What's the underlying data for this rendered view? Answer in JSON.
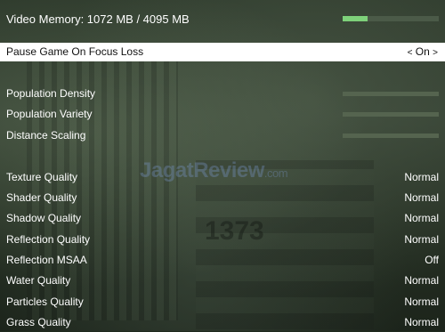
{
  "watermark": {
    "name": "JagatReview",
    "suffix": ".com"
  },
  "background_number": "1373",
  "video_memory": {
    "label": "Video Memory: 1072 MB / 4095 MB",
    "used_fraction": 0.26
  },
  "pause_game": {
    "label": "Pause Game On Focus Loss",
    "value": "On",
    "left_arrow": "<",
    "right_arrow": ">"
  },
  "sliders": [
    {
      "label": "Population Density"
    },
    {
      "label": "Population Variety"
    },
    {
      "label": "Distance Scaling"
    }
  ],
  "settings": [
    {
      "label": "Texture Quality",
      "value": "Normal"
    },
    {
      "label": "Shader Quality",
      "value": "Normal"
    },
    {
      "label": "Shadow Quality",
      "value": "Normal"
    },
    {
      "label": "Reflection Quality",
      "value": "Normal"
    },
    {
      "label": "Reflection MSAA",
      "value": "Off"
    },
    {
      "label": "Water Quality",
      "value": "Normal"
    },
    {
      "label": "Particles Quality",
      "value": "Normal"
    },
    {
      "label": "Grass Quality",
      "value": "Normal"
    }
  ],
  "colors": {
    "memory_fill": "#7ed17a",
    "highlight_bg": "#ffffff",
    "slider_bg": "#55644f"
  }
}
